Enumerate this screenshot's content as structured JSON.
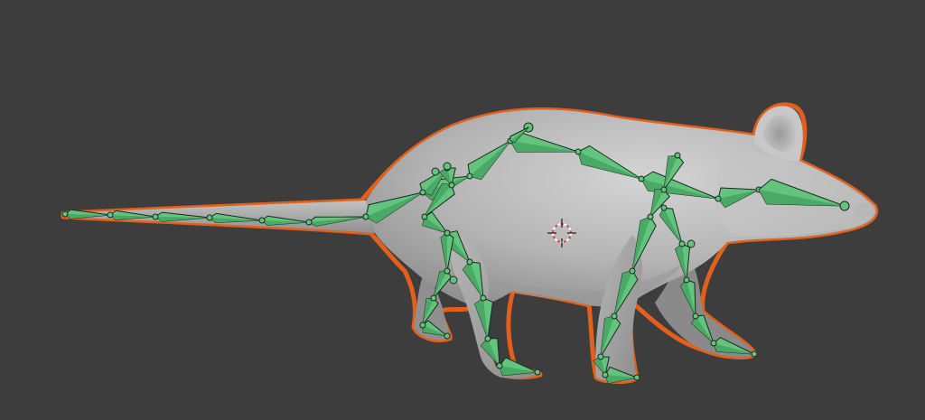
{
  "colors": {
    "background": "#3d3d3d",
    "mesh_light": "#c9c9c9",
    "mesh_mid": "#a8a8a8",
    "mesh_dark": "#7b7b7b",
    "selection_outline": "#e2601c",
    "bone_fill": "#62c47d",
    "bone_stroke": "#1b2a1f",
    "cursor_red": "#e04040",
    "cursor_white": "#ffffff"
  },
  "viewport": {
    "scene_name": "3d-viewport",
    "object": "rat-mesh",
    "armature": "rat-armature",
    "cursor_icon": "3d-cursor-icon"
  }
}
